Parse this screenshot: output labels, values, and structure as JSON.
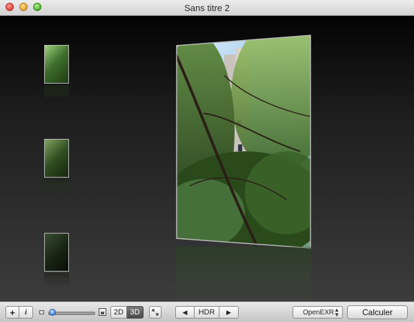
{
  "window": {
    "title": "Sans titre 2"
  },
  "icons": {
    "close": "close-traffic-light",
    "minimize": "minimize-traffic-light",
    "zoom": "zoom-traffic-light",
    "small_photo": "small-photo-icon",
    "large_photo": "large-photo-icon",
    "fullscreen": "fullscreen-arrows-icon"
  },
  "toolbar": {
    "add_label": "+",
    "info_label": "i",
    "size_slider_value": 0.05,
    "view_2d_label": "2D",
    "view_3d_label": "3D",
    "active_view": "3D",
    "prev_label": "◀",
    "hdr_label": "HDR",
    "next_label": "▶",
    "format_selected": "OpenEXR",
    "calculate_label": "Calculer"
  },
  "thumbnails": {
    "count": 3
  },
  "colors": {
    "accent": "#3d84d8",
    "stage_top": "#040404",
    "stage_bottom": "#3c3c3c"
  }
}
